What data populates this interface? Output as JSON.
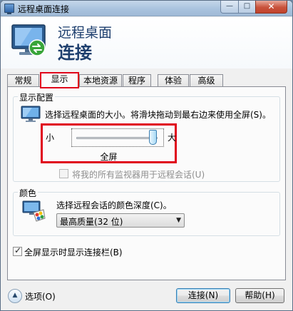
{
  "window": {
    "title": "远程桌面连接",
    "min": "—",
    "max": "□",
    "close": "✕"
  },
  "header": {
    "line1": "远程桌面",
    "line2": "连接"
  },
  "tabs": [
    {
      "label": "常规"
    },
    {
      "label": "显示"
    },
    {
      "label": "本地资源"
    },
    {
      "label": "程序"
    },
    {
      "label": "体验"
    },
    {
      "label": "高级"
    }
  ],
  "display_config": {
    "legend": "显示配置",
    "description": "选择远程桌面的大小。将滑块拖动到最右边来使用全屏(S)。",
    "slider_min_label": "小",
    "slider_max_label": "大",
    "slider_value_label": "全屏",
    "slider_level": 1.0,
    "multi_monitor_label": "将我的所有监视器用于远程会话(U)",
    "multi_monitor_checked": false
  },
  "colors": {
    "legend": "颜色",
    "description": "选择远程会话的颜色深度(C)。",
    "depth_selected": "最高质量(32 位)"
  },
  "fullscreen_bar": {
    "label": "全屏显示时显示连接栏(B)",
    "checked": true
  },
  "footer": {
    "options_label": "选项(O)",
    "connect_label": "连接(N)",
    "help_label": "帮助(H)"
  },
  "accent": {
    "highlight": "#e0001a",
    "title_blue": "#1e3f6e"
  }
}
